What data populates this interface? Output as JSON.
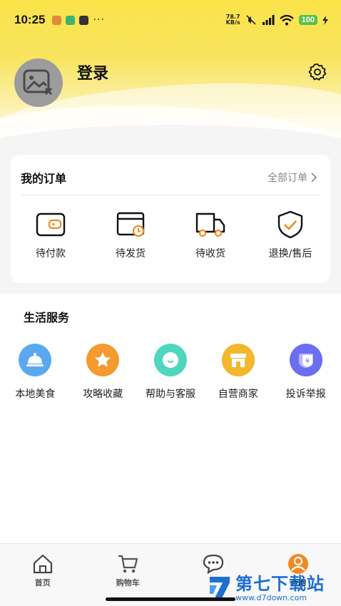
{
  "status_bar": {
    "time": "10:25",
    "more": "···",
    "speed": "78.7",
    "speed_unit": "KB/s",
    "battery": "100"
  },
  "profile": {
    "login_label": "登录"
  },
  "orders": {
    "title": "我的订单",
    "all_label": "全部订单",
    "items": [
      {
        "label": "待付款",
        "icon": "wallet-icon"
      },
      {
        "label": "待发货",
        "icon": "package-clock-icon"
      },
      {
        "label": "待收货",
        "icon": "truck-icon"
      },
      {
        "label": "退换/售后",
        "icon": "shield-check-icon"
      }
    ]
  },
  "services": {
    "title": "生活服务",
    "items": [
      {
        "label": "本地美食",
        "icon": "food-cloche-icon",
        "color": "#5aa9f0"
      },
      {
        "label": "攻略收藏",
        "icon": "star-icon",
        "color": "#f59a2f"
      },
      {
        "label": "帮助与客服",
        "icon": "chat-bubble-icon",
        "color": "#4fd6c0"
      },
      {
        "label": "自营商家",
        "icon": "store-icon",
        "color": "#f3b72c"
      },
      {
        "label": "投诉举报",
        "icon": "report-card-icon",
        "color": "#6b6ef0"
      }
    ]
  },
  "tabbar": {
    "items": [
      {
        "label": "首页",
        "icon": "home-icon"
      },
      {
        "label": "购物车",
        "icon": "cart-icon"
      },
      {
        "label": "",
        "icon": "message-icon"
      },
      {
        "label": "我的",
        "icon": "profile-icon"
      }
    ]
  },
  "watermark": {
    "name": "第七下载站",
    "url": "www.d7down.com"
  },
  "colors": {
    "accent_yellow": "#fbe34a",
    "order_icon_orange": "#f08a24"
  }
}
